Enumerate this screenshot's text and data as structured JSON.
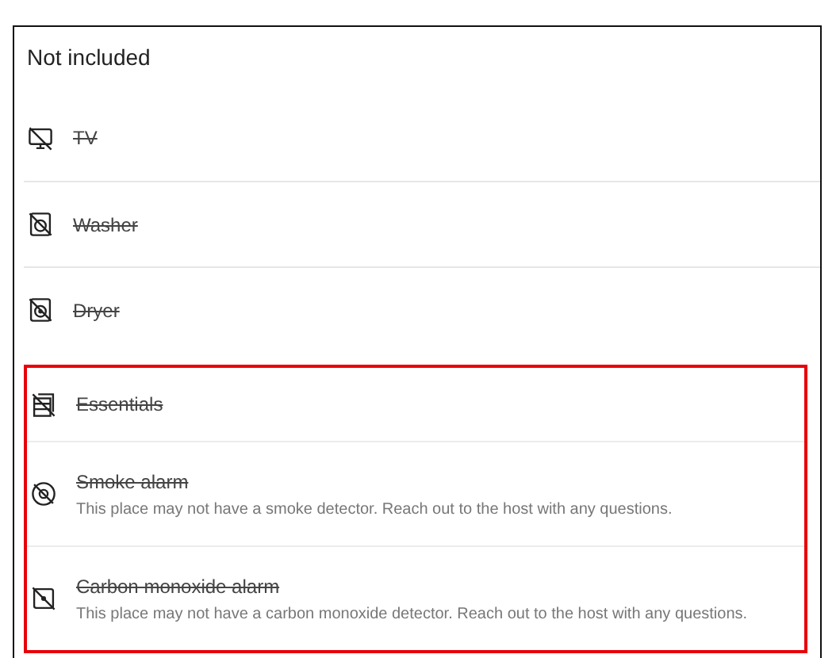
{
  "heading": "Not included",
  "items": [
    {
      "name": "TV",
      "unavailable": true,
      "highlighted": false
    },
    {
      "name": "Washer",
      "unavailable": true,
      "highlighted": false
    },
    {
      "name": "Dryer",
      "unavailable": true,
      "highlighted": false
    },
    {
      "name": "Essentials",
      "unavailable": true,
      "highlighted": true
    },
    {
      "name": "Smoke alarm",
      "unavailable": true,
      "highlighted": true,
      "description": "This place may not have a smoke detector. Reach out to the host with any questions."
    },
    {
      "name": "Carbon monoxide alarm",
      "unavailable": true,
      "highlighted": true,
      "description": "This place may not have a carbon monoxide detector. Reach out to the host with any questions."
    }
  ]
}
